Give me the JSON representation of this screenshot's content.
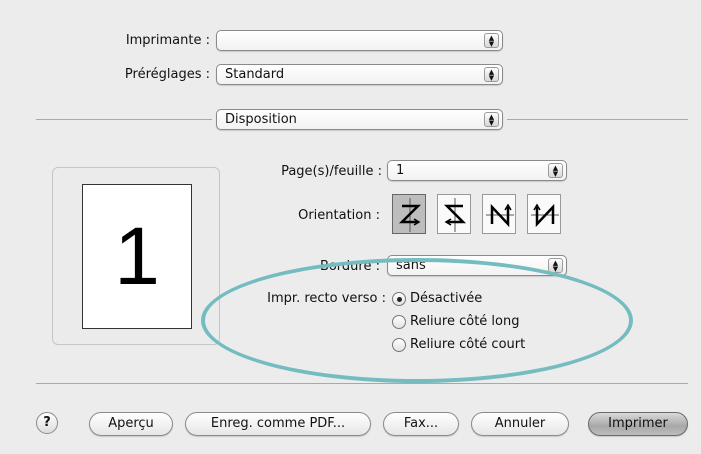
{
  "printer": {
    "label": "Imprimante :",
    "value": ""
  },
  "presets": {
    "label": "Préréglages :",
    "value": "Standard"
  },
  "panel": {
    "value": "Disposition"
  },
  "preview": {
    "page_number": "1"
  },
  "layout": {
    "pages_per_sheet": {
      "label": "Page(s)/feuille :",
      "value": "1"
    },
    "orientation": {
      "label": "Orientation :",
      "options": [
        {
          "icon": "orientation-z-icon",
          "selected": true
        },
        {
          "icon": "orientation-reverse-z-icon",
          "selected": false
        },
        {
          "icon": "orientation-n-icon",
          "selected": false
        },
        {
          "icon": "orientation-reverse-n-icon",
          "selected": false
        }
      ]
    },
    "border": {
      "label": "Bordure :",
      "value": "sans"
    }
  },
  "duplex": {
    "label": "Impr. recto verso :",
    "options": [
      {
        "label": "Désactivée",
        "checked": true
      },
      {
        "label": "Reliure côté long",
        "checked": false
      },
      {
        "label": "Reliure côté court",
        "checked": false
      }
    ]
  },
  "highlight_color": "#74bcc0",
  "buttons": {
    "help": "?",
    "preview": "Aperçu",
    "save_pdf": "Enreg. comme PDF...",
    "fax": "Fax...",
    "cancel": "Annuler",
    "print": "Imprimer"
  }
}
